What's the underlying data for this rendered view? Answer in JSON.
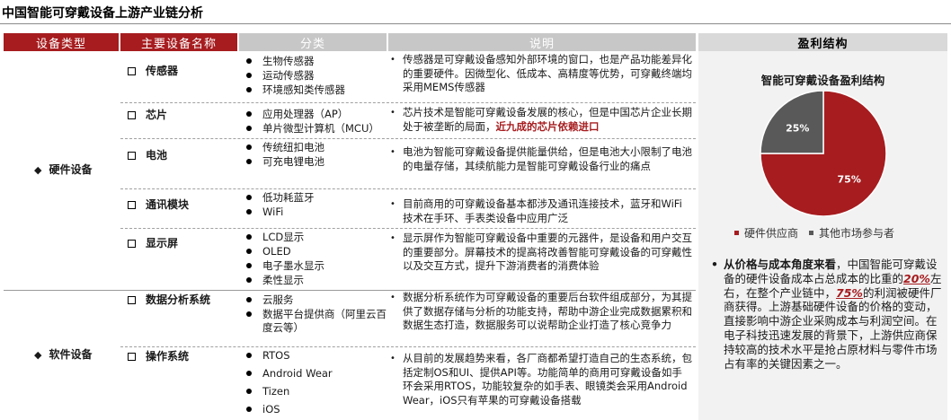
{
  "title": "中国智能可穿戴设备上游产业链分析",
  "headers": {
    "type": "设备类型",
    "device": "主要设备名称",
    "classification": "分类",
    "description": "说明",
    "profit": "盈利结构"
  },
  "categories": {
    "hardware": "硬件设备",
    "software": "软件设备"
  },
  "rows": [
    {
      "name": "传感器",
      "items": [
        "生物传感器",
        "运动传感器",
        "环境感知类传感器"
      ],
      "desc": "传感器是可穿戴设备感知外部环境的窗口，也是产品功能差异化的重要硬件。因微型化、低成本、高精度等优势，可穿戴终端均采用MEMS传感器"
    },
    {
      "name": "芯片",
      "items": [
        "应用处理器（AP）",
        "单片微型计算机（MCU）"
      ],
      "desc_a": "芯片技术是智能可穿戴设备发展的核心，但是中国芯片企业长期处于被垄断的局面，",
      "desc_hl": "近九成的芯片依赖进口"
    },
    {
      "name": "电池",
      "items": [
        "传统纽扣电池",
        "可充电锂电池"
      ],
      "desc": "电池为智能可穿戴设备提供能量供给，但是电池大小限制了电池的电量存储，其续航能力是智能可穿戴设备行业的痛点"
    },
    {
      "name": "通讯模块",
      "items": [
        "低功耗蓝牙",
        "WiFi"
      ],
      "desc": "目前商用的可穿戴设备基本都涉及通讯连接技术，蓝牙和WiFi技术在手环、手表类设备中应用广泛"
    },
    {
      "name": "显示屏",
      "items": [
        "LCD显示",
        "OLED",
        "电子墨水显示",
        "柔性显示"
      ],
      "desc": "显示屏作为智能可穿戴设备中重要的元器件，是设备和用户交互的重要部分。屏幕技术的提高将改善智能可穿戴设备的可穿戴性以及交互方式，提升下游消费者的消费体验"
    },
    {
      "name": "数据分析系统",
      "items": [
        "云服务",
        "数据平台提供商（阿里云百度云等）"
      ],
      "desc": "数据分析系统作为可穿戴设备的重要后台软件组成部分，为其提供了数据存储与分析的功能支持，帮助中游企业完成数据累积和数据生态打造，数据服务可以说帮助企业打造了核心竞争力"
    },
    {
      "name": "操作系统",
      "items": [
        "RTOS",
        "Android Wear",
        "Tizen",
        "iOS"
      ],
      "desc": "从目前的发展趋势来看，各厂商都希望打造自己的生态系统，包括定制OS和UI、提供API等。功能简单的商用可穿戴设备如手环会采用RTOS，功能较复杂的如手表、眼镜类会采用Android Wear，iOS只有苹果的可穿戴设备搭载"
    }
  ],
  "profit": {
    "chart_title": "智能可穿戴设备盈利结构",
    "legend": [
      "硬件供应商",
      "其他市场参与者"
    ],
    "text_bold": "从价格与成本角度来看",
    "text_1": "，中国智能可穿戴设备的硬件设备成本占总成本的比重的",
    "pct_a": "20%",
    "text_2": "左右，在整个产业链中，",
    "pct_b": "75%",
    "text_3": "的利润被硬件厂商获得。上游基础硬件设备的价格的变动，直接影响中游企业采购成本与利润空间。在电子科技迅速发展的背景下，上游供应商保持较高的技术水平是抢占原材料与零件市场占有率的关键因素之一。"
  },
  "colors": {
    "accent": "#a61c1f",
    "other": "#595959"
  },
  "chart_data": {
    "type": "pie",
    "title": "智能可穿戴设备盈利结构",
    "labels": [
      "硬件供应商",
      "其他市场参与者"
    ],
    "values": [
      75,
      25
    ],
    "value_labels": [
      "75%",
      "25%"
    ],
    "legend_position": "bottom"
  }
}
